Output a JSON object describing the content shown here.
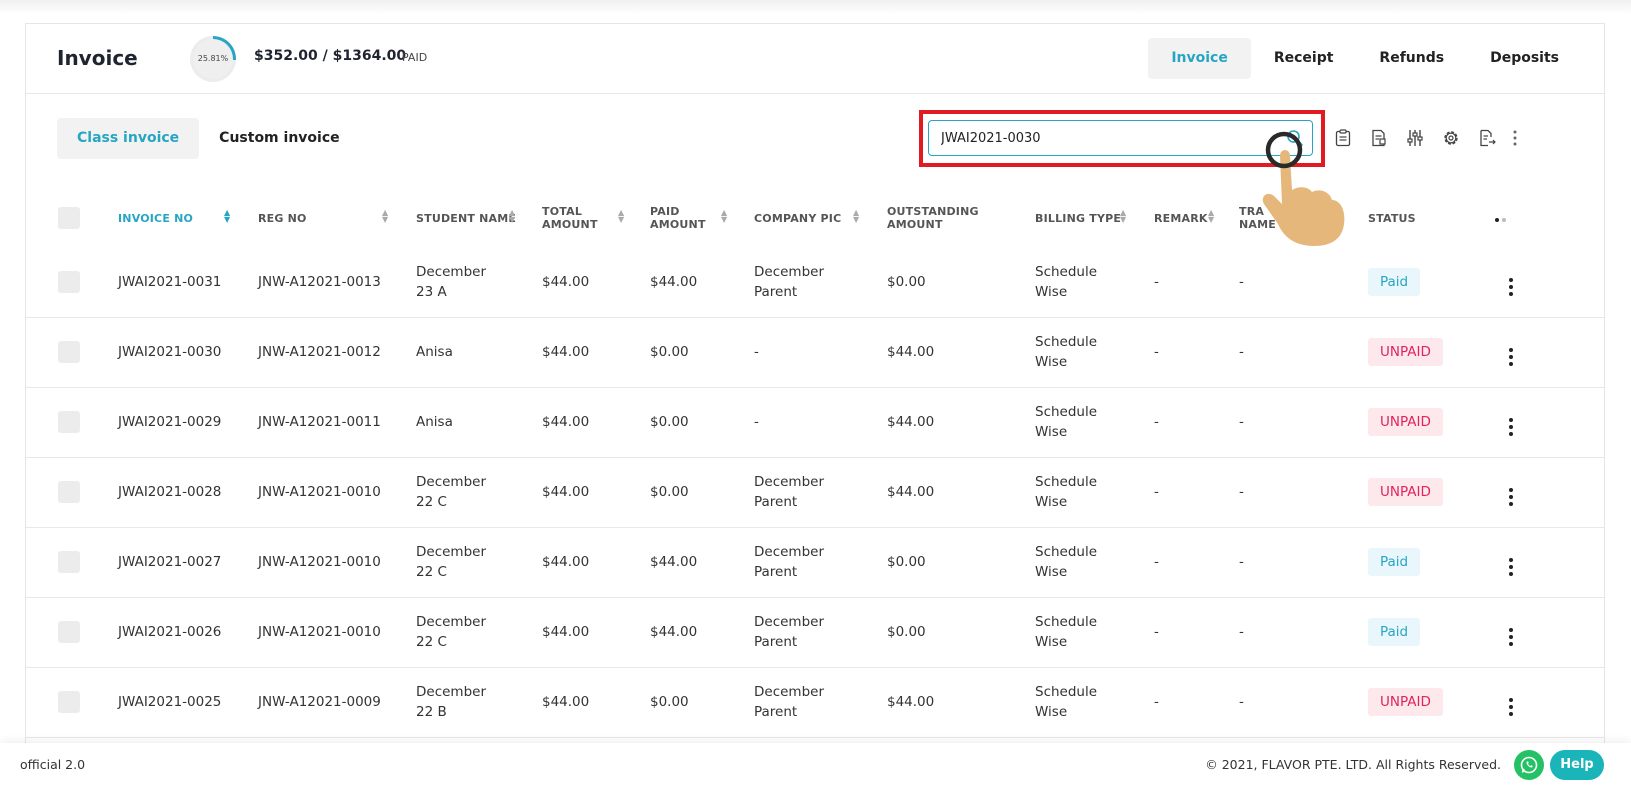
{
  "header": {
    "title": "Invoice",
    "progress_label": "25.81%",
    "progress_fraction": 0.2581,
    "amount": "$352.00 / $1364.00",
    "paid_label": "PAID",
    "tabs": [
      "Invoice",
      "Receipt",
      "Refunds",
      "Deposits"
    ],
    "active_tab": "Invoice"
  },
  "subtabs": [
    "Class invoice",
    "Custom invoice"
  ],
  "search": {
    "value": "JWAI2021-0030",
    "icon": "search-icon"
  },
  "toolbar_icons": [
    "clipboard-icon",
    "report-icon",
    "sliders-icon",
    "gear-icon",
    "export-file-icon",
    "more-vertical-icon"
  ],
  "columns": {
    "invoice_no": "INVOICE NO",
    "reg_no": "REG NO",
    "student_name": "STUDENT NAME",
    "total_amount_1": "TOTAL",
    "total_amount_2": "AMOUNT",
    "paid_amount_1": "PAID",
    "paid_amount_2": "AMOUNT",
    "company_pic": "COMPANY PIC",
    "outstanding_1": "OUTSTANDING",
    "outstanding_2": "AMOUNT",
    "billing_type": "BILLING TYPE",
    "remark": "REMARK",
    "tra_1": "TRA",
    "tra_2": "NAME",
    "status": "STATUS"
  },
  "rows": [
    {
      "invoice_no": "JWAI2021-0031",
      "reg_no": "JNW-A12021-0013",
      "student_1": "December",
      "student_2": "23 A",
      "total": "$44.00",
      "paid": "$44.00",
      "company_1": "December",
      "company_2": "Parent",
      "outstanding": "$0.00",
      "billing_1": "Schedule",
      "billing_2": "Wise",
      "remark": "-",
      "tra": "-",
      "status": "Paid"
    },
    {
      "invoice_no": "JWAI2021-0030",
      "reg_no": "JNW-A12021-0012",
      "student_1": "Anisa",
      "student_2": "",
      "total": "$44.00",
      "paid": "$0.00",
      "company_1": "-",
      "company_2": "",
      "outstanding": "$44.00",
      "billing_1": "Schedule",
      "billing_2": "Wise",
      "remark": "-",
      "tra": "-",
      "status": "UNPAID"
    },
    {
      "invoice_no": "JWAI2021-0029",
      "reg_no": "JNW-A12021-0011",
      "student_1": "Anisa",
      "student_2": "",
      "total": "$44.00",
      "paid": "$0.00",
      "company_1": "-",
      "company_2": "",
      "outstanding": "$44.00",
      "billing_1": "Schedule",
      "billing_2": "Wise",
      "remark": "-",
      "tra": "-",
      "status": "UNPAID"
    },
    {
      "invoice_no": "JWAI2021-0028",
      "reg_no": "JNW-A12021-0010",
      "student_1": "December",
      "student_2": "22 C",
      "total": "$44.00",
      "paid": "$0.00",
      "company_1": "December",
      "company_2": "Parent",
      "outstanding": "$44.00",
      "billing_1": "Schedule",
      "billing_2": "Wise",
      "remark": "-",
      "tra": "-",
      "status": "UNPAID"
    },
    {
      "invoice_no": "JWAI2021-0027",
      "reg_no": "JNW-A12021-0010",
      "student_1": "December",
      "student_2": "22 C",
      "total": "$44.00",
      "paid": "$44.00",
      "company_1": "December",
      "company_2": "Parent",
      "outstanding": "$0.00",
      "billing_1": "Schedule",
      "billing_2": "Wise",
      "remark": "-",
      "tra": "-",
      "status": "Paid"
    },
    {
      "invoice_no": "JWAI2021-0026",
      "reg_no": "JNW-A12021-0010",
      "student_1": "December",
      "student_2": "22 C",
      "total": "$44.00",
      "paid": "$44.00",
      "company_1": "December",
      "company_2": "Parent",
      "outstanding": "$0.00",
      "billing_1": "Schedule",
      "billing_2": "Wise",
      "remark": "-",
      "tra": "-",
      "status": "Paid"
    },
    {
      "invoice_no": "JWAI2021-0025",
      "reg_no": "JNW-A12021-0009",
      "student_1": "December",
      "student_2": "22 B",
      "total": "$44.00",
      "paid": "$0.00",
      "company_1": "December",
      "company_2": "Parent",
      "outstanding": "$44.00",
      "billing_1": "Schedule",
      "billing_2": "Wise",
      "remark": "-",
      "tra": "-",
      "status": "UNPAID"
    }
  ],
  "footer": {
    "version": "official 2.0",
    "copyright": "© 2021, FLAVOR PTE. LTD. All Rights Reserved.",
    "help": "Help"
  },
  "colors": {
    "accent": "#26a6c3",
    "highlight": "#e11b22",
    "unpaid": "#e0245e",
    "whatsapp": "#25c265",
    "help": "#1ab5b8"
  }
}
